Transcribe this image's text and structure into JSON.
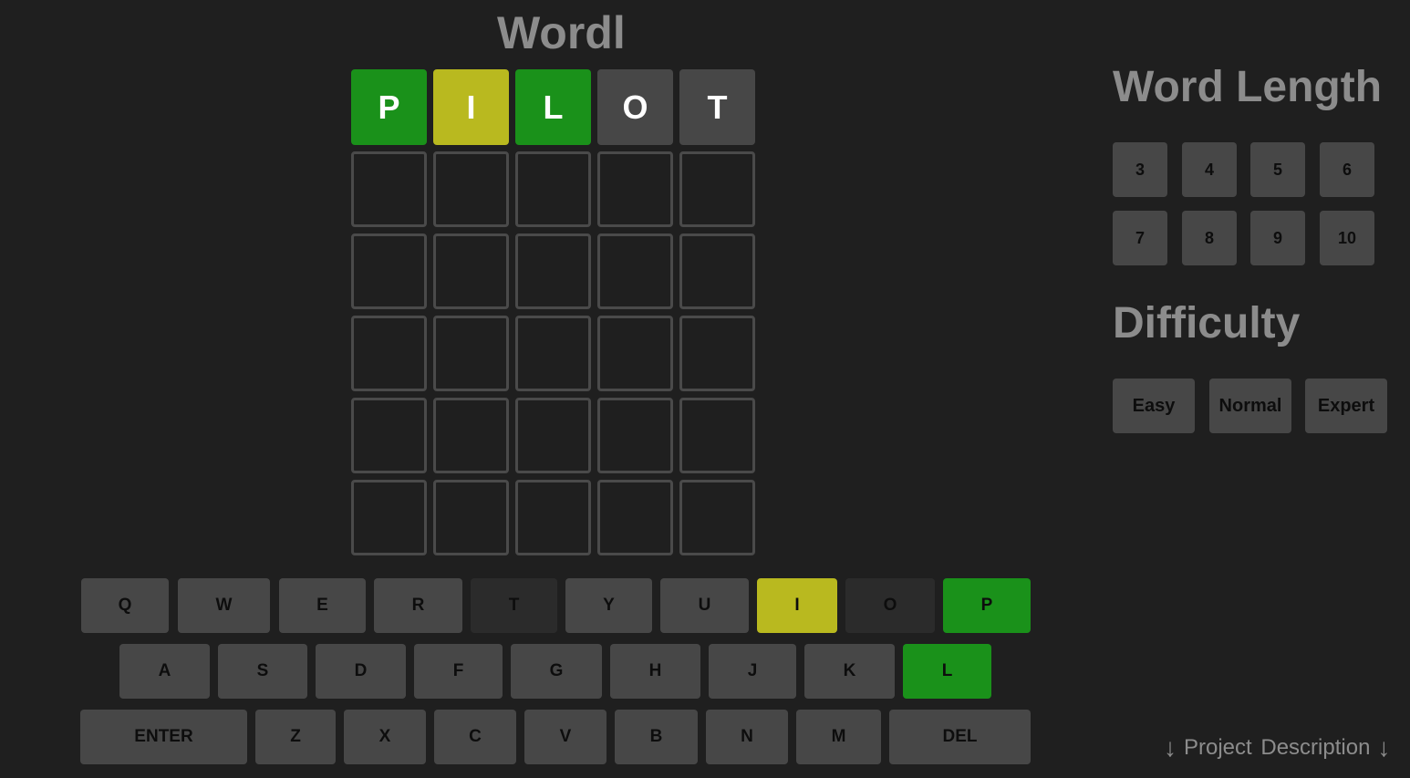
{
  "app": {
    "title": "Wordl"
  },
  "colors": {
    "correct": "#1a911a",
    "present": "#b9b91f",
    "absent": "#474747",
    "used_key": "#2b2b2b",
    "empty_border": "#4a4a4a",
    "key_default": "#474747"
  },
  "board": {
    "rows": [
      [
        {
          "letter": "P",
          "state": "correct"
        },
        {
          "letter": "I",
          "state": "present"
        },
        {
          "letter": "L",
          "state": "correct"
        },
        {
          "letter": "O",
          "state": "absent"
        },
        {
          "letter": "T",
          "state": "absent"
        }
      ],
      [
        {
          "letter": "",
          "state": "empty"
        },
        {
          "letter": "",
          "state": "empty"
        },
        {
          "letter": "",
          "state": "empty"
        },
        {
          "letter": "",
          "state": "empty"
        },
        {
          "letter": "",
          "state": "empty"
        }
      ],
      [
        {
          "letter": "",
          "state": "empty"
        },
        {
          "letter": "",
          "state": "empty"
        },
        {
          "letter": "",
          "state": "empty"
        },
        {
          "letter": "",
          "state": "empty"
        },
        {
          "letter": "",
          "state": "empty"
        }
      ],
      [
        {
          "letter": "",
          "state": "empty"
        },
        {
          "letter": "",
          "state": "empty"
        },
        {
          "letter": "",
          "state": "empty"
        },
        {
          "letter": "",
          "state": "empty"
        },
        {
          "letter": "",
          "state": "empty"
        }
      ],
      [
        {
          "letter": "",
          "state": "empty"
        },
        {
          "letter": "",
          "state": "empty"
        },
        {
          "letter": "",
          "state": "empty"
        },
        {
          "letter": "",
          "state": "empty"
        },
        {
          "letter": "",
          "state": "empty"
        }
      ],
      [
        {
          "letter": "",
          "state": "empty"
        },
        {
          "letter": "",
          "state": "empty"
        },
        {
          "letter": "",
          "state": "empty"
        },
        {
          "letter": "",
          "state": "empty"
        },
        {
          "letter": "",
          "state": "empty"
        }
      ]
    ]
  },
  "keyboard": {
    "rows": [
      [
        {
          "label": "Q",
          "state": "default"
        },
        {
          "label": "W",
          "state": "default"
        },
        {
          "label": "E",
          "state": "default"
        },
        {
          "label": "R",
          "state": "default"
        },
        {
          "label": "T",
          "state": "used"
        },
        {
          "label": "Y",
          "state": "default"
        },
        {
          "label": "U",
          "state": "default"
        },
        {
          "label": "I",
          "state": "present"
        },
        {
          "label": "O",
          "state": "used"
        },
        {
          "label": "P",
          "state": "correct"
        }
      ],
      [
        {
          "label": "A",
          "state": "default"
        },
        {
          "label": "S",
          "state": "default"
        },
        {
          "label": "D",
          "state": "default"
        },
        {
          "label": "F",
          "state": "default"
        },
        {
          "label": "G",
          "state": "default"
        },
        {
          "label": "H",
          "state": "default"
        },
        {
          "label": "J",
          "state": "default"
        },
        {
          "label": "K",
          "state": "default"
        },
        {
          "label": "L",
          "state": "correct"
        }
      ],
      [
        {
          "label": "ENTER",
          "state": "default"
        },
        {
          "label": "Z",
          "state": "default"
        },
        {
          "label": "X",
          "state": "default"
        },
        {
          "label": "C",
          "state": "default"
        },
        {
          "label": "V",
          "state": "default"
        },
        {
          "label": "B",
          "state": "default"
        },
        {
          "label": "N",
          "state": "default"
        },
        {
          "label": "M",
          "state": "default"
        },
        {
          "label": "DEL",
          "state": "default"
        }
      ]
    ]
  },
  "settings": {
    "word_length_heading": "Word Length",
    "word_lengths": [
      "3",
      "4",
      "5",
      "6",
      "7",
      "8",
      "9",
      "10"
    ],
    "difficulty_heading": "Difficulty",
    "difficulties": [
      "Easy",
      "Normal",
      "Expert"
    ]
  },
  "footer": {
    "project_description": "Project Description",
    "arrow_icon": "down-arrow-icon"
  }
}
